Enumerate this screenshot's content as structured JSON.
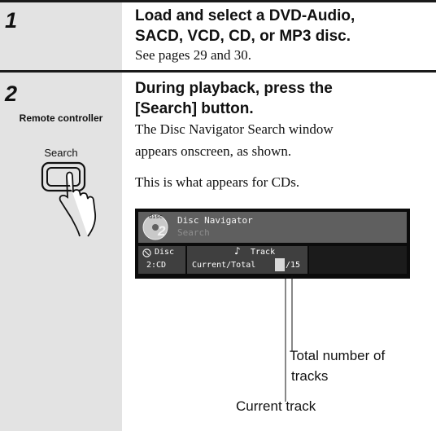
{
  "step1": {
    "number": "1",
    "heading_line1": "Load and select a DVD-Audio,",
    "heading_line2": "SACD, VCD, CD, or MP3 disc.",
    "body": "See pages 29 and 30."
  },
  "step2": {
    "number": "2",
    "remote_label": "Remote controller",
    "button_label": "Search",
    "heading_line1": "During playback, press the",
    "heading_line2": "[Search] button.",
    "body_line1": "The Disc Navigator Search window",
    "body_line2": "appears onscreen, as shown.",
    "note": "This is what appears for CDs."
  },
  "screen": {
    "title": "Disc Navigator",
    "subtitle": "Search",
    "disc_icon_label": "disc",
    "disc_icon_number": "2",
    "disc_label": "Disc",
    "disc_value": "2:CD",
    "track_label": "Track",
    "track_caption": "Current/Total",
    "total_tracks": "/15"
  },
  "callouts": {
    "total_line1": "Total number of",
    "total_line2": "tracks",
    "current": "Current track"
  },
  "icons": [
    "disc-icon",
    "music-note-icon",
    "hand-press-icon"
  ]
}
